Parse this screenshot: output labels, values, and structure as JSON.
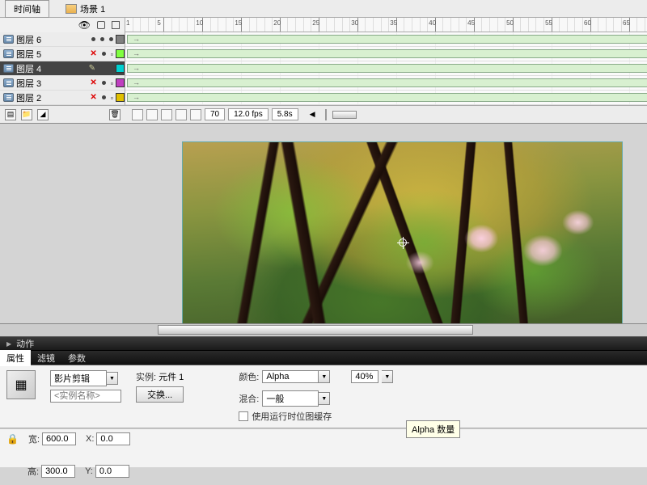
{
  "tabs": {
    "timeline": "时间轴",
    "scene_prefix": "场景",
    "scene_num": "1"
  },
  "ruler": {
    "start": 1,
    "step": 5,
    "end": 85,
    "playhead_frame": 70
  },
  "layers": [
    {
      "name": "图层 6",
      "selected": false,
      "x_lock": false,
      "icon2": "dot",
      "color": "#808080"
    },
    {
      "name": "图层 5",
      "selected": false,
      "x_lock": true,
      "icon2": "doc",
      "color": "#80ff40"
    },
    {
      "name": "图层 4",
      "selected": true,
      "x_lock": false,
      "icon2": "pencil",
      "color": "#00d0d0"
    },
    {
      "name": "图层 3",
      "selected": false,
      "x_lock": true,
      "icon2": "doc",
      "color": "#c040c0"
    },
    {
      "name": "图层 2",
      "selected": false,
      "x_lock": true,
      "icon2": "doc",
      "color": "#e0c000"
    }
  ],
  "playback": {
    "frame": "70",
    "fps": "12.0 fps",
    "time": "5.8s"
  },
  "actions": {
    "label": "动作"
  },
  "props_tabs": {
    "properties": "属性",
    "filters": "滤镜",
    "params": "参数"
  },
  "inspector": {
    "clip_type": "影片剪辑",
    "instance_placeholder": "<实例名称>",
    "swap_btn": "交换...",
    "instance_label": "实例:",
    "instance_value": "元件 1",
    "color_label": "颜色:",
    "color_mode": "Alpha",
    "alpha_value": "40%",
    "alpha_tooltip": "Alpha 数量",
    "blend_label": "混合:",
    "blend_value": "一般",
    "cache_label": "使用运行时位图缓存"
  },
  "dims": {
    "w_label": "宽:",
    "w": "600.0",
    "h_label": "高:",
    "h": "300.0",
    "x_label": "X:",
    "x": "0.0",
    "y_label": "Y:",
    "y": "0.0"
  }
}
